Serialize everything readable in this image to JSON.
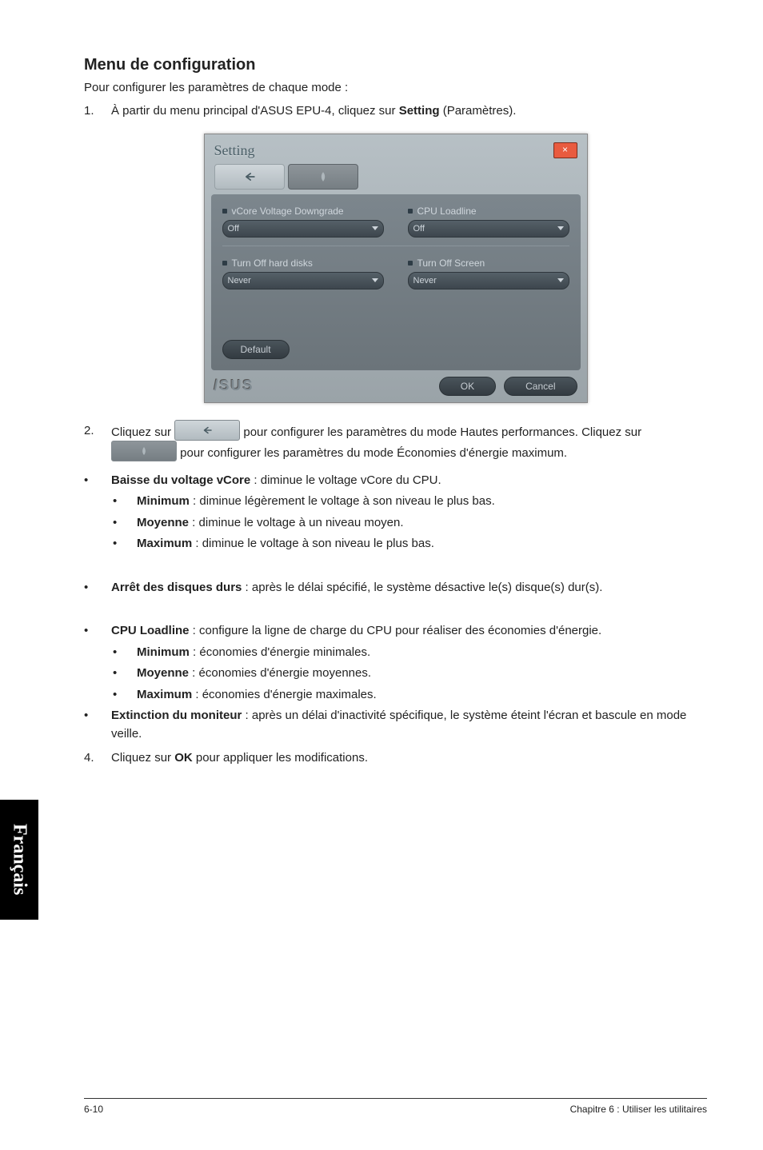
{
  "side_tab": "Français",
  "title": "Menu de configuration",
  "intro": "Pour configurer les paramètres de chaque mode :",
  "step1": {
    "num": "1.",
    "pre": "À partir du menu principal d'ASUS EPU-4, cliquez sur ",
    "bold": "Setting",
    "post": " (Paramètres)."
  },
  "shot": {
    "title": "Setting",
    "close": "×",
    "vcore_label": "vCore Voltage Downgrade",
    "vcore_value": "Off",
    "loadline_label": "CPU Loadline",
    "loadline_value": "Off",
    "hdd_label": "Turn Off hard disks",
    "hdd_value": "Never",
    "screen_label": "Turn Off Screen",
    "screen_value": "Never",
    "default": "Default",
    "ok": "OK",
    "cancel": "Cancel",
    "logo": "/SUS"
  },
  "step2": {
    "num": "2.",
    "t1": "Cliquez sur ",
    "t2": " pour configurer les paramètres du mode Hautes performances. Cliquez sur ",
    "t3": " pour configurer les paramètres du mode Économies d'énergie maximum."
  },
  "b_vcore": {
    "bold": "Baisse du voltage vCore",
    "rest": " : diminue le voltage vCore du CPU."
  },
  "sub_min1": {
    "bold": "Minimum",
    "rest": " : diminue légèrement le voltage à son niveau le plus bas."
  },
  "sub_moy1": {
    "bold": "Moyenne",
    "rest": " : diminue le voltage à un niveau moyen."
  },
  "sub_max1": {
    "bold": "Maximum",
    "rest": " : diminue le voltage à son niveau le plus bas."
  },
  "b_hdd": {
    "bold": "Arrêt des disques durs",
    "rest": " : après le délai spécifié, le système désactive le(s) disque(s) dur(s)."
  },
  "b_loadline": {
    "bold": "CPU Loadline",
    "rest": " : configure la ligne de charge du CPU pour réaliser des économies d'énergie."
  },
  "sub_min2": {
    "bold": "Minimum",
    "rest": " : économies d'énergie minimales."
  },
  "sub_moy2": {
    "bold": "Moyenne",
    "rest": " : économies d'énergie moyennes."
  },
  "sub_max2": {
    "bold": "Maximum",
    "rest": " : économies d'énergie maximales."
  },
  "b_monitor": {
    "bold": "Extinction du moniteur",
    "rest": " : après un délai d'inactivité spécifique, le système éteint l'écran et bascule en mode veille."
  },
  "step4": {
    "num": "4.",
    "t1": "Cliquez sur ",
    "bold": "OK",
    "t2": " pour appliquer les modifications."
  },
  "footer": {
    "left": "6-10",
    "right": "Chapitre 6 : Utiliser les utilitaires"
  }
}
